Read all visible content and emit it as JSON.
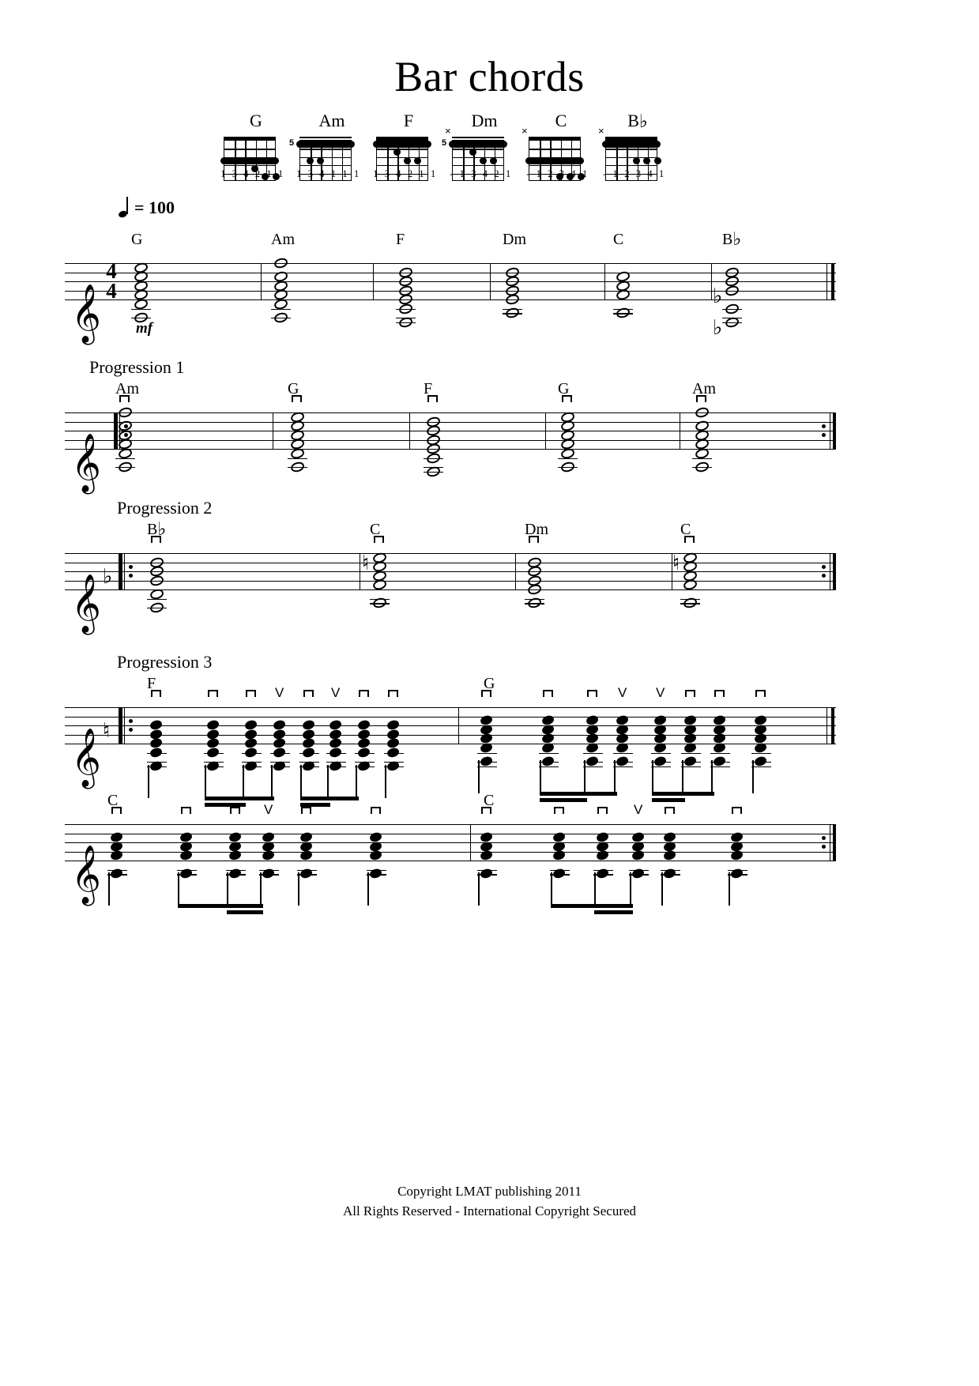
{
  "title": "Bar chords",
  "tempo": {
    "note": "quarter",
    "text": "= 100",
    "bpm": 100
  },
  "dynamic": "mf",
  "time_signature": {
    "top": "4",
    "bottom": "4"
  },
  "clef": "treble",
  "chord_diagrams": [
    {
      "name": "G",
      "accidental": "",
      "fret_marker": "",
      "mute": "",
      "fingers": "1 3 4 2 1 1",
      "barre_fret": 3,
      "dots": [
        [
          4,
          4
        ],
        [
          5,
          5
        ],
        [
          5,
          6
        ]
      ]
    },
    {
      "name": "Am",
      "accidental": "",
      "fret_marker": "5",
      "mute": "",
      "fingers": "1 3 4 1 1 1",
      "barre_fret": 1,
      "dots": [
        [
          3,
          2
        ],
        [
          3,
          3
        ]
      ]
    },
    {
      "name": "F",
      "accidental": "",
      "fret_marker": "",
      "mute": "",
      "fingers": "1 3 4 2 1 1",
      "barre_fret": 1,
      "dots": [
        [
          2,
          3
        ],
        [
          3,
          5
        ],
        [
          3,
          4
        ]
      ]
    },
    {
      "name": "Dm",
      "accidental": "",
      "fret_marker": "5",
      "mute": "×",
      "fingers": "- 1 3 4 2 1",
      "barre_fret": 1,
      "dots": [
        [
          2,
          3
        ],
        [
          3,
          5
        ],
        [
          3,
          4
        ]
      ]
    },
    {
      "name": "C",
      "accidental": "",
      "fret_marker": "",
      "mute": "×",
      "fingers": "- 1 2 3 4 1",
      "barre_fret": 3,
      "dots": [
        [
          5,
          4
        ],
        [
          5,
          5
        ],
        [
          5,
          6
        ]
      ]
    },
    {
      "name": "B",
      "accidental": "♭",
      "fret_marker": "",
      "mute": "×",
      "fingers": "- 1 2 3 4 1",
      "barre_fret": 1,
      "dots": [
        [
          3,
          4
        ],
        [
          3,
          5
        ],
        [
          3,
          6
        ]
      ]
    }
  ],
  "systems": [
    {
      "id": "system-1",
      "section_label": "",
      "measures": [
        {
          "chord": "G",
          "accidental": ""
        },
        {
          "chord": "Am",
          "accidental": ""
        },
        {
          "chord": "F",
          "accidental": ""
        },
        {
          "chord": "Dm",
          "accidental": ""
        },
        {
          "chord": "C",
          "accidental": ""
        },
        {
          "chord": "B",
          "accidental": "♭"
        }
      ]
    },
    {
      "id": "system-2",
      "section_label": "Progression 1",
      "measures": [
        {
          "chord": "Am",
          "accidental": ""
        },
        {
          "chord": "G",
          "accidental": ""
        },
        {
          "chord": "F",
          "accidental": ""
        },
        {
          "chord": "G",
          "accidental": ""
        },
        {
          "chord": "Am",
          "accidental": ""
        }
      ]
    },
    {
      "id": "system-3",
      "section_label": "Progression 2",
      "measures": [
        {
          "chord": "B",
          "accidental": "♭"
        },
        {
          "chord": "C",
          "accidental": ""
        },
        {
          "chord": "Dm",
          "accidental": ""
        },
        {
          "chord": "C",
          "accidental": ""
        }
      ]
    },
    {
      "id": "system-4",
      "section_label": "Progression 3",
      "measures": [
        {
          "chord": "F",
          "accidental": ""
        },
        {
          "chord": "G",
          "accidental": ""
        }
      ]
    },
    {
      "id": "system-5",
      "section_label": "",
      "measures": [
        {
          "chord": "C",
          "accidental": ""
        },
        {
          "chord": "C",
          "accidental": ""
        }
      ]
    }
  ],
  "strum_symbols": {
    "down": "⊓",
    "up": "V"
  },
  "footer": {
    "line1": "Copyright LMAT publishing 2011",
    "line2": "All Rights Reserved - International Copyright Secured"
  }
}
